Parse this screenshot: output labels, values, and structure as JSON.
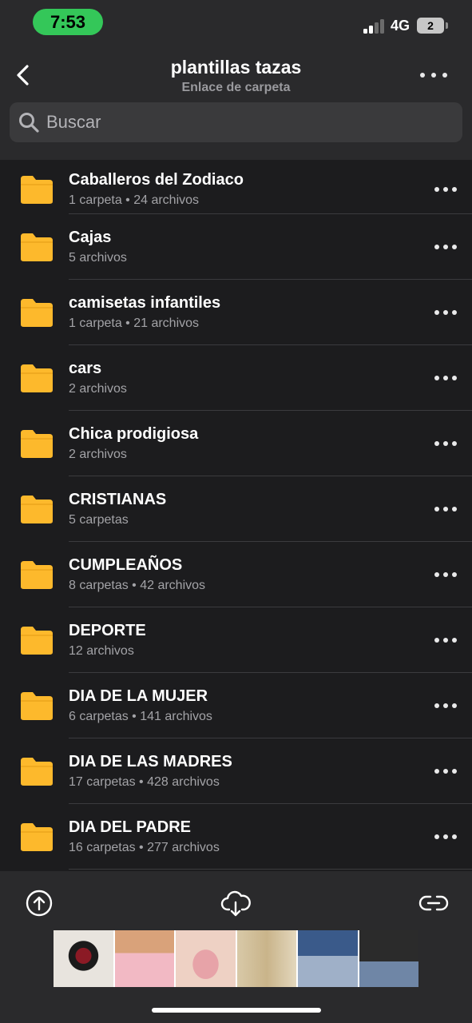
{
  "status": {
    "time": "7:53",
    "network": "4G",
    "battery": "2"
  },
  "header": {
    "title": "plantillas tazas",
    "subtitle": "Enlace de carpeta"
  },
  "search": {
    "placeholder": "Buscar"
  },
  "folders": [
    {
      "name": "Caballeros del Zodiaco",
      "meta": "1 carpeta • 24 archivos"
    },
    {
      "name": "Cajas",
      "meta": "5 archivos"
    },
    {
      "name": "camisetas infantiles",
      "meta": "1 carpeta • 21 archivos"
    },
    {
      "name": "cars",
      "meta": "2 archivos"
    },
    {
      "name": "Chica prodigiosa",
      "meta": "2 archivos"
    },
    {
      "name": "CRISTIANAS",
      "meta": "5 carpetas"
    },
    {
      "name": "CUMPLEAÑOS",
      "meta": "8 carpetas • 42 archivos"
    },
    {
      "name": "DEPORTE",
      "meta": "12 archivos"
    },
    {
      "name": "DIA DE LA MUJER",
      "meta": "6 carpetas • 141 archivos"
    },
    {
      "name": "DIA DE LAS MADRES",
      "meta": "17 carpetas • 428 archivos"
    },
    {
      "name": "DIA DEL PADRE",
      "meta": "16 carpetas • 277 archivos"
    }
  ],
  "toolbar": {
    "upload_icon": "cloud-upload-icon",
    "download_icon": "cloud-download-icon",
    "link_icon": "link-icon"
  },
  "colors": {
    "folder": "#fdb92c",
    "background": "#1c1c1e",
    "bar": "#2a2a2c",
    "time_pill": "#34c759"
  }
}
